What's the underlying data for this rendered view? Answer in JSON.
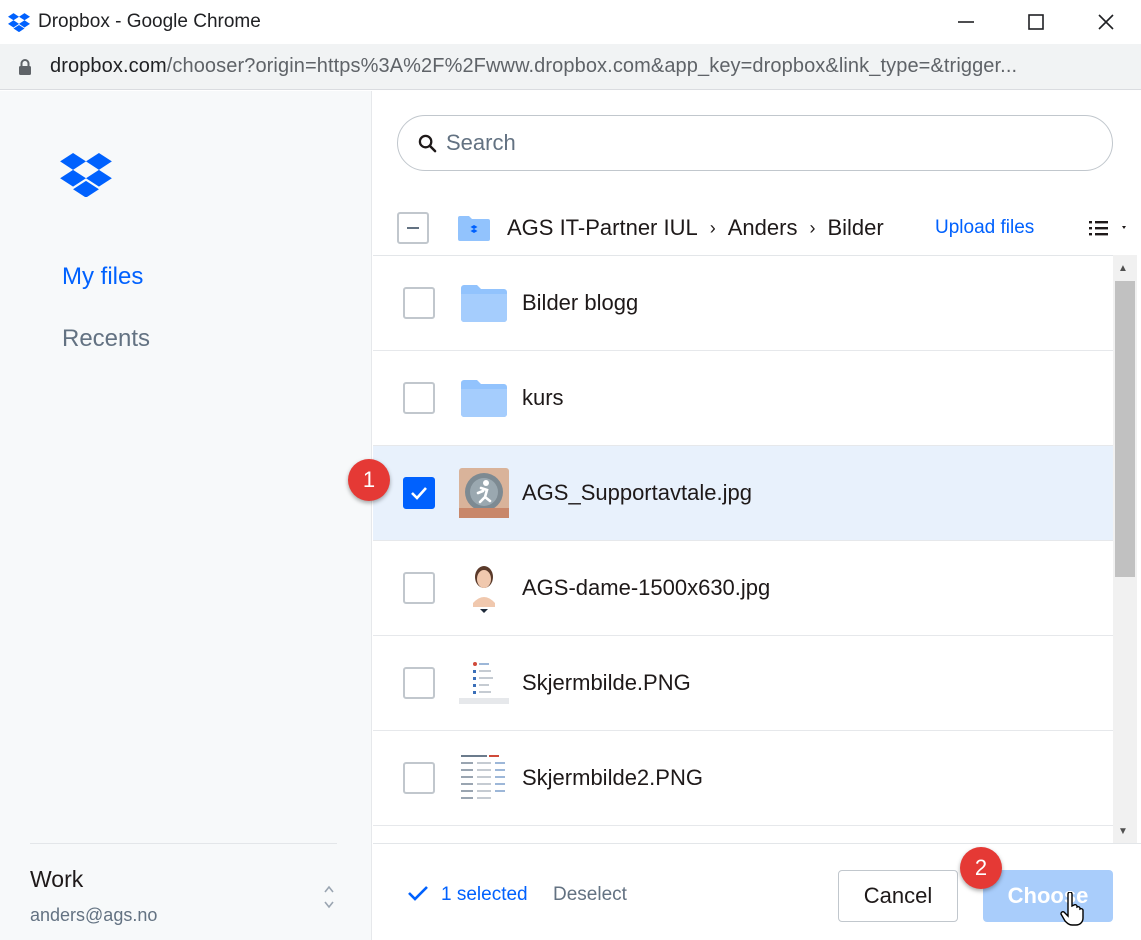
{
  "window": {
    "title": "Dropbox - Google Chrome",
    "app_icon": "dropbox-icon",
    "controls": {
      "minimize": "—",
      "maximize": "☐",
      "close": "✕"
    }
  },
  "address_bar": {
    "lock_icon": "lock-icon",
    "host": "dropbox.com",
    "path": "/chooser?origin=https%3A%2F%2Fwww.dropbox.com&app_key=dropbox&link_type=&trigger..."
  },
  "sidebar": {
    "logo": "dropbox-logo",
    "items": [
      {
        "label": "My files",
        "active": true
      },
      {
        "label": "Recents",
        "active": false
      }
    ],
    "account": {
      "name": "Work",
      "email": "anders@ags.no"
    }
  },
  "search": {
    "placeholder": "Search",
    "icon": "search-icon"
  },
  "path": {
    "crumbs": [
      "AGS IT-Partner IUL",
      "Anders",
      "Bilder"
    ],
    "separator": "›",
    "upload_label": "Upload files",
    "view_icon": "list-view-icon"
  },
  "files": [
    {
      "name": "Bilder blogg",
      "type": "folder",
      "selected": false
    },
    {
      "name": "kurs",
      "type": "folder",
      "selected": false
    },
    {
      "name": "AGS_Supportavtale.jpg",
      "type": "image",
      "selected": true
    },
    {
      "name": "AGS-dame-1500x630.jpg",
      "type": "image",
      "selected": false
    },
    {
      "name": "Skjermbilde.PNG",
      "type": "screenshot",
      "selected": false
    },
    {
      "name": "Skjermbilde2.PNG",
      "type": "screenshot",
      "selected": false
    }
  ],
  "footer": {
    "selected_label": "1 selected",
    "deselect_label": "Deselect",
    "cancel_label": "Cancel",
    "choose_label": "Choose"
  },
  "annotations": {
    "step1": "1",
    "step2": "2"
  },
  "colors": {
    "accent": "#0061fe",
    "folder": "#92c3fd",
    "selected_row": "#e8f1fc",
    "marker": "#e53935",
    "choose_disabled": "#a9cdfb"
  }
}
